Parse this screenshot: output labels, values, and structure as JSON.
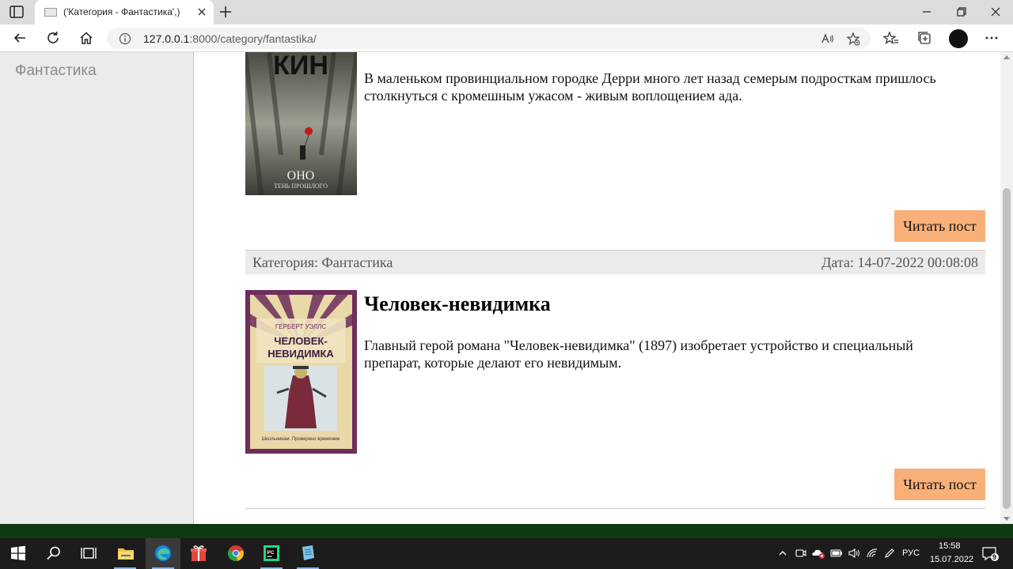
{
  "browser": {
    "tab_title": "('Категория - Фантастика',)",
    "url_host": "127.0.0.1",
    "url_rest": ":8000/category/fantastika/"
  },
  "sidebar": {
    "items": [
      {
        "label": "Фантастика"
      }
    ]
  },
  "posts": [
    {
      "cover_title": "КИН",
      "cover_subtitle": "ОНО",
      "cover_caption": "ТЕНЬ ПРОШЛОГО",
      "excerpt": "В маленьком провинциальном городке Дерри много лет назад семерым подросткам пришлось столкнуться с кромешным ужасом - живым воплощением ада.",
      "read_label": "Читать пост",
      "category": "Категория: Фантастика",
      "date": "Дата: 14-07-2022 00:08:08"
    },
    {
      "title": "Человек-невидимка",
      "cover_author": "ГЕРБЕРТ УЭЛЛС",
      "cover_title_1": "ЧЕЛОВЕК-",
      "cover_title_2": "НЕВИДИМКА",
      "cover_series": "Школьникам. Проверено временем",
      "excerpt": "Главный герой романа \"Человек-невидимка\" (1897) изобретает устройство и специальный препарат, которые делают его невидимым.",
      "read_label": "Читать пост"
    }
  ],
  "taskbar": {
    "lang": "РУС",
    "time": "15:58",
    "date": "15.07.2022",
    "notifications": "9"
  },
  "colors": {
    "button": "#f9b078",
    "meta_bg": "#ebebeb",
    "footer": "#0e3a12"
  }
}
